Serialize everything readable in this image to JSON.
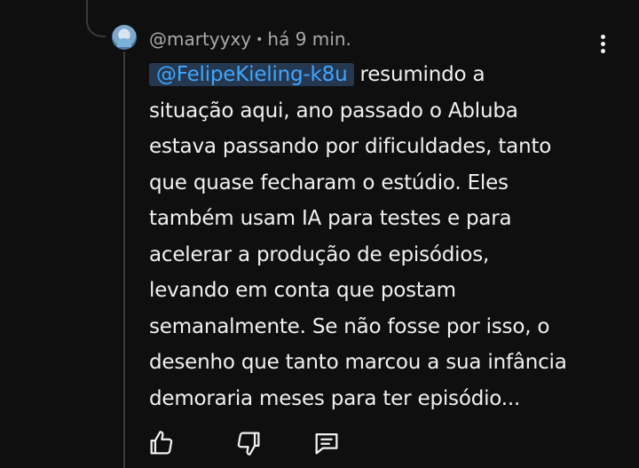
{
  "comment": {
    "author": "@martyyxy",
    "separator": "•",
    "time": "há 9 min.",
    "mention": "@FelipeKieling-k8u",
    "lines": [
      "resumindo a",
      "situação aqui, ano passado o Abluba",
      "estava passando por dificuldades, tanto",
      "que quase fecharam o estúdio. Eles",
      "também usam IA para testes e para",
      "acelerar a produção de episódios,",
      "levando em conta que postam",
      "semanalmente. Se não fosse por isso, o",
      "desenho que tanto marcou a sua infância",
      "demoraria meses para ter episódio..."
    ]
  },
  "icons": {
    "menu": "more-vertical-icon",
    "like": "thumbs-up-icon",
    "dislike": "thumbs-down-icon",
    "reply": "reply-comment-icon"
  },
  "colors": {
    "background": "#0f0f0f",
    "text": "#f1f1f1",
    "meta": "#aaaaaa",
    "mention": "#3ea6ff",
    "mention_bg": "#263850"
  }
}
